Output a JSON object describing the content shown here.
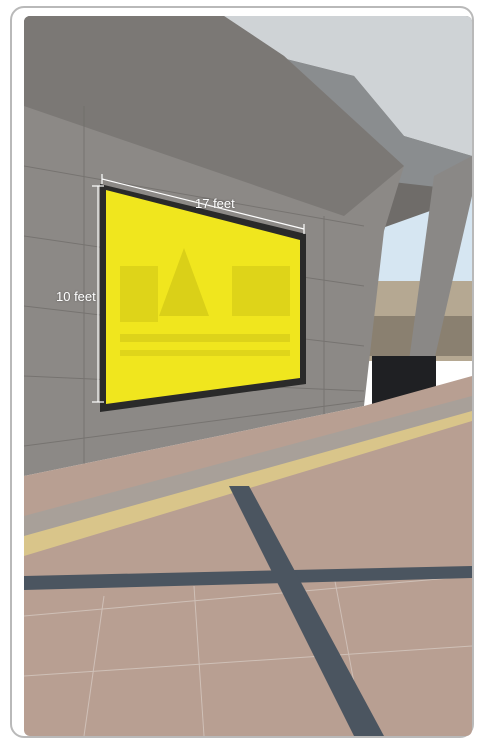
{
  "scene": {
    "subject": "billboard-on-wall",
    "billboard_color": "#f0e61e",
    "wall_color": "#8c8986",
    "floor_color": "#b89f92"
  },
  "dimensions": {
    "width_label": "17 feet",
    "height_label": "10 feet"
  }
}
